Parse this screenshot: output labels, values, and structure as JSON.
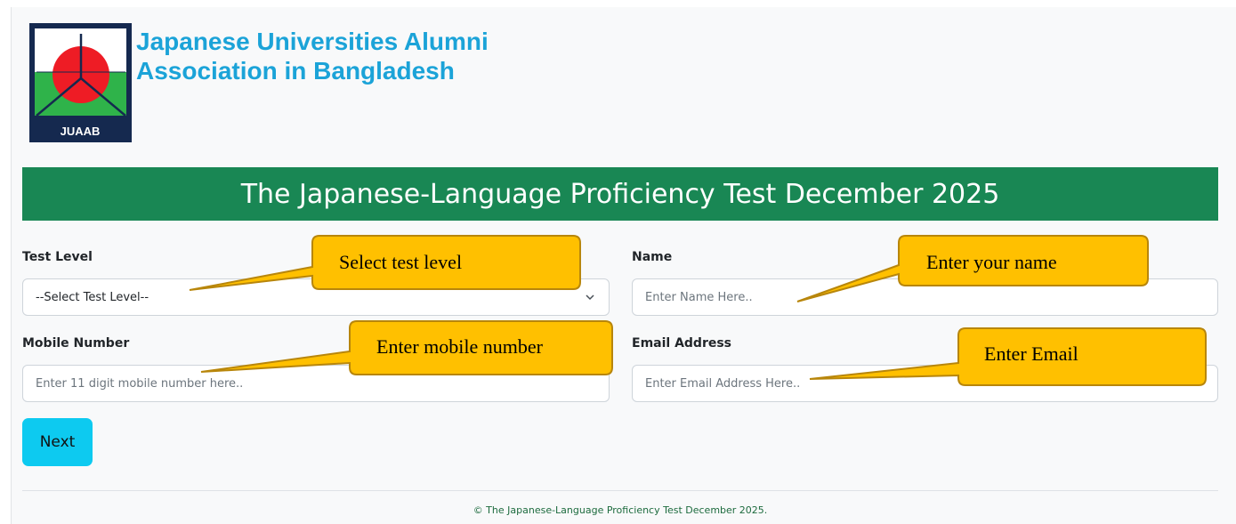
{
  "brand": {
    "logo_text": "JUAAB",
    "title_line1": "Japanese Universities Alumni",
    "title_line2": "Association in Bangladesh"
  },
  "banner": {
    "title": "The Japanese-Language Proficiency Test December 2025"
  },
  "form": {
    "test_level": {
      "label": "Test Level",
      "value": "--Select Test Level--"
    },
    "name": {
      "label": "Name",
      "placeholder": "Enter Name Here.."
    },
    "mobile": {
      "label": "Mobile Number",
      "placeholder": "Enter 11 digit mobile number here.."
    },
    "email": {
      "label": "Email Address",
      "placeholder": "Enter Email Address Here.."
    },
    "next_label": "Next"
  },
  "footer": {
    "text": "© The Japanese-Language Proficiency Test December 2025."
  },
  "callouts": {
    "test_level": "Select test level",
    "name": "Enter your name",
    "mobile": "Enter mobile number",
    "email": "Enter Email"
  },
  "colors": {
    "banner": "#198754",
    "brand_title": "#1ba3d8",
    "button": "#0dcaf0",
    "callout_fill": "#ffc000",
    "callout_stroke": "#b8860b",
    "logo_bg": "#15294f",
    "logo_red": "#ee1c25",
    "logo_green": "#2fb34a"
  }
}
